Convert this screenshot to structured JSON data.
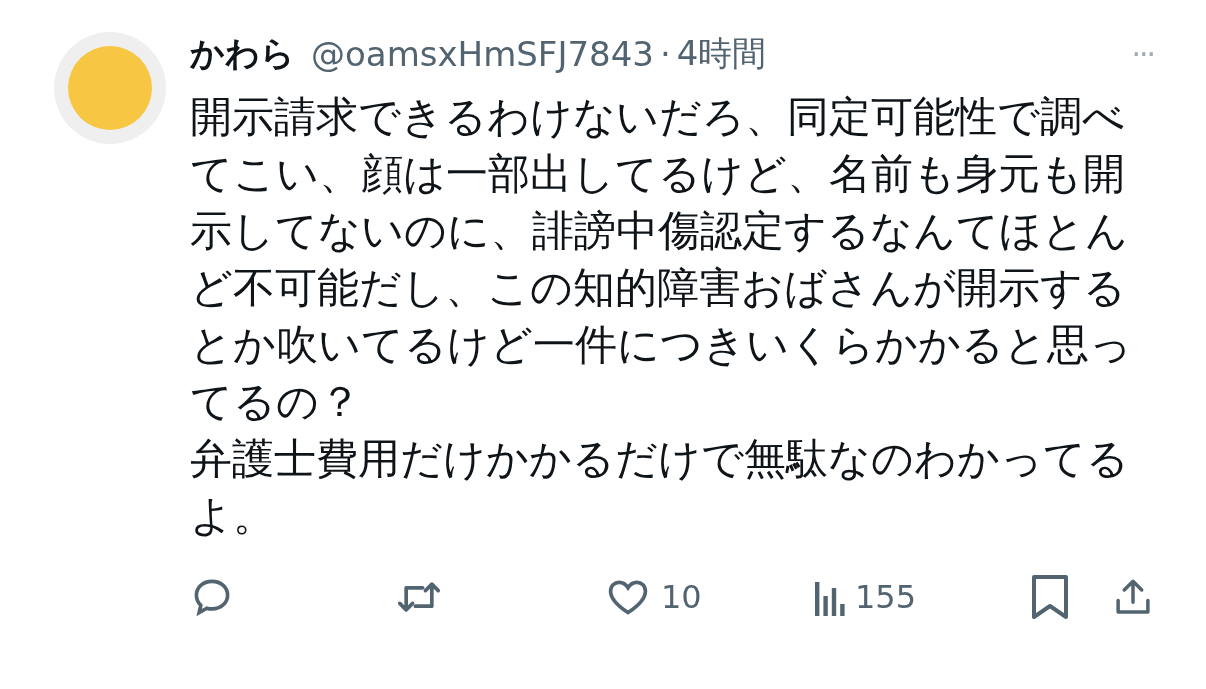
{
  "tweet": {
    "name": "かわら",
    "handle": "@oamsxHmSFJ7843",
    "separator": "·",
    "time": "4時間",
    "more": "···",
    "body": [
      "開示請求できるわけないだろ、同定可能性で調べてこい、顔は一部出してるけど、名前も身元も開示してないのに、誹謗中傷認定するなんてほとんど不可能だし、この知的障害おばさんが開示するとか吹いてるけど一件につきいくらかかると思ってるの？",
      "弁護士費用だけかかるだけで無駄なのわかってるよ。"
    ],
    "actions": [
      {
        "kind": "reply"
      },
      {
        "kind": "retweet"
      },
      {
        "kind": "like",
        "count": "10"
      },
      {
        "kind": "views",
        "count": "155"
      },
      {
        "kind": "bookmark"
      },
      {
        "kind": "share"
      }
    ]
  }
}
